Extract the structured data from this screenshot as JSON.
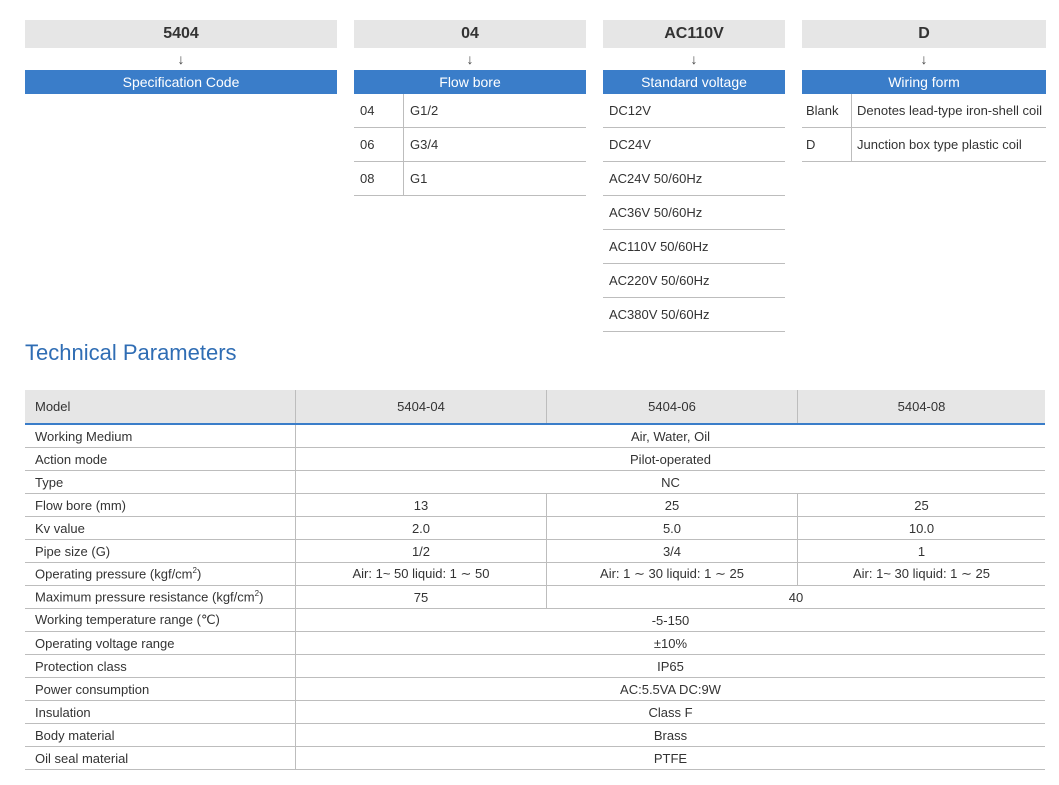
{
  "codes": {
    "spec": {
      "code": "5404",
      "arrow": "↓",
      "heading": "Specification Code"
    },
    "bore": {
      "code": "04",
      "arrow": "↓",
      "heading": "Flow bore",
      "rows": [
        {
          "k": "04",
          "v": "G1/2"
        },
        {
          "k": "06",
          "v": "G3/4"
        },
        {
          "k": "08",
          "v": "G1"
        }
      ]
    },
    "voltage": {
      "code": "AC110V",
      "arrow": "↓",
      "heading": "Standard voltage",
      "rows": [
        "DC12V",
        "DC24V",
        "AC24V 50/60Hz",
        "AC36V 50/60Hz",
        "AC110V 50/60Hz",
        "AC220V 50/60Hz",
        "AC380V 50/60Hz"
      ]
    },
    "wiring": {
      "code": "D",
      "arrow": "↓",
      "heading": "Wiring form",
      "rows": [
        {
          "k": "Blank",
          "v": "Denotes lead-type iron-shell coil"
        },
        {
          "k": "D",
          "v": "Junction box type plastic coil"
        }
      ]
    }
  },
  "section_title": "Technical Parameters",
  "params": {
    "header": {
      "label": "Model",
      "m1": "5404-04",
      "m2": "5404-06",
      "m3": "5404-08"
    },
    "working_medium": {
      "label": "Working Medium",
      "value": "Air, Water, Oil"
    },
    "action_mode": {
      "label": "Action mode",
      "value": "Pilot-operated"
    },
    "type": {
      "label": "Type",
      "value": "NC"
    },
    "flow_bore": {
      "label": "Flow bore  (mm)",
      "v1": "13",
      "v2": "25",
      "v3": "25"
    },
    "kv": {
      "label": "Kv value",
      "v1": "2.0",
      "v2": "5.0",
      "v3": "10.0"
    },
    "pipe": {
      "label": "Pipe size (G)",
      "v1": "1/2",
      "v2": "3/4",
      "v3": "1"
    },
    "op_pressure": {
      "label": "Operating pressure  (kgf/cm",
      "sup": "2",
      "label_end": ")",
      "v1": "Air: 1~ 50  liquid: 1 ∼ 50",
      "v2": "Air: 1 ∼ 30  liquid: 1 ∼ 25",
      "v3": "Air: 1~ 30  liquid: 1 ∼ 25"
    },
    "max_pressure": {
      "label": "Maximum pressure resistance  (kgf/cm",
      "sup": "2",
      "label_end": ")",
      "v1": "75",
      "v23": "40"
    },
    "temp": {
      "label": "Working temperature range  (℃)",
      "value": "-5-150"
    },
    "volt_range": {
      "label": "Operating voltage range",
      "value": "±10%"
    },
    "protection": {
      "label": "Protection class",
      "value": "IP65"
    },
    "power": {
      "label": "Power consumption",
      "value": "AC:5.5VA DC:9W"
    },
    "insulation": {
      "label": "Insulation",
      "value": "Class F"
    },
    "body": {
      "label": "Body material",
      "value": "Brass"
    },
    "seal": {
      "label": "Oil seal material",
      "value": "PTFE"
    }
  },
  "colors": {
    "accent": "#3a7dc9",
    "title": "#2f6db4",
    "band": "#e6e6e6"
  }
}
